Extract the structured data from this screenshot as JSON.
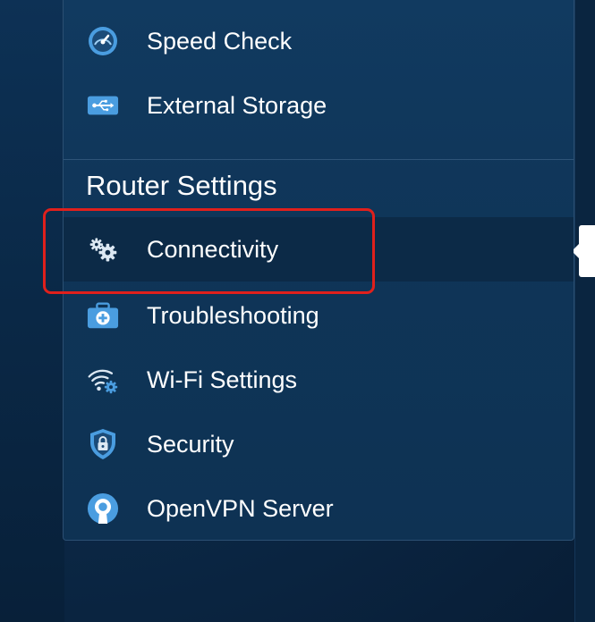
{
  "menu": {
    "top_items": [
      {
        "label": "Speed Check",
        "icon": "speedometer-icon"
      },
      {
        "label": "External Storage",
        "icon": "usb-icon"
      }
    ],
    "section_title": "Router Settings",
    "items": [
      {
        "label": "Connectivity",
        "icon": "gears-icon",
        "active": true
      },
      {
        "label": "Troubleshooting",
        "icon": "first-aid-kit-icon"
      },
      {
        "label": "Wi-Fi Settings",
        "icon": "wifi-gear-icon"
      },
      {
        "label": "Security",
        "icon": "shield-lock-icon"
      },
      {
        "label": "OpenVPN Server",
        "icon": "openvpn-icon"
      }
    ]
  },
  "colors": {
    "icon_blue": "#4a9de0",
    "icon_light": "#dce8f3",
    "highlight": "#e0201c",
    "active_bg": "#0c2a47"
  }
}
